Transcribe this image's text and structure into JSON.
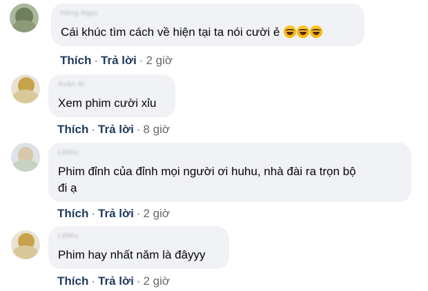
{
  "comments": [
    {
      "author": "Hồng Ngọc",
      "text": "Cái khúc tìm cách về hiện tại ta nói cười ẻ",
      "emoji_icon": "laughing-crying-emoji",
      "emoji_count": 3,
      "like": "Thích",
      "reply": "Trả lời",
      "time": "2 giờ"
    },
    {
      "author": "Xuân Ái",
      "text": "Xem phim cười xỉu",
      "like": "Thích",
      "reply": "Trả lời",
      "time": "8 giờ"
    },
    {
      "author": "LệMiu",
      "text_line1": "Phim đỉnh của đỉnh mọi người ơi huhu, nhà đài ra trọn bộ",
      "text_line2": "đi ạ",
      "like": "Thích",
      "reply": "Trả lời",
      "time": "2 giờ"
    },
    {
      "author": "LệMiu",
      "text": "Phim hay nhất năm là đâyyy",
      "like": "Thích",
      "reply": "Trả lời",
      "time": "2 giờ"
    }
  ],
  "separator": "·",
  "colors": {
    "bubble": "#f0f2f5",
    "action_text": "#1f3a5f",
    "meta_text": "#65676b"
  }
}
